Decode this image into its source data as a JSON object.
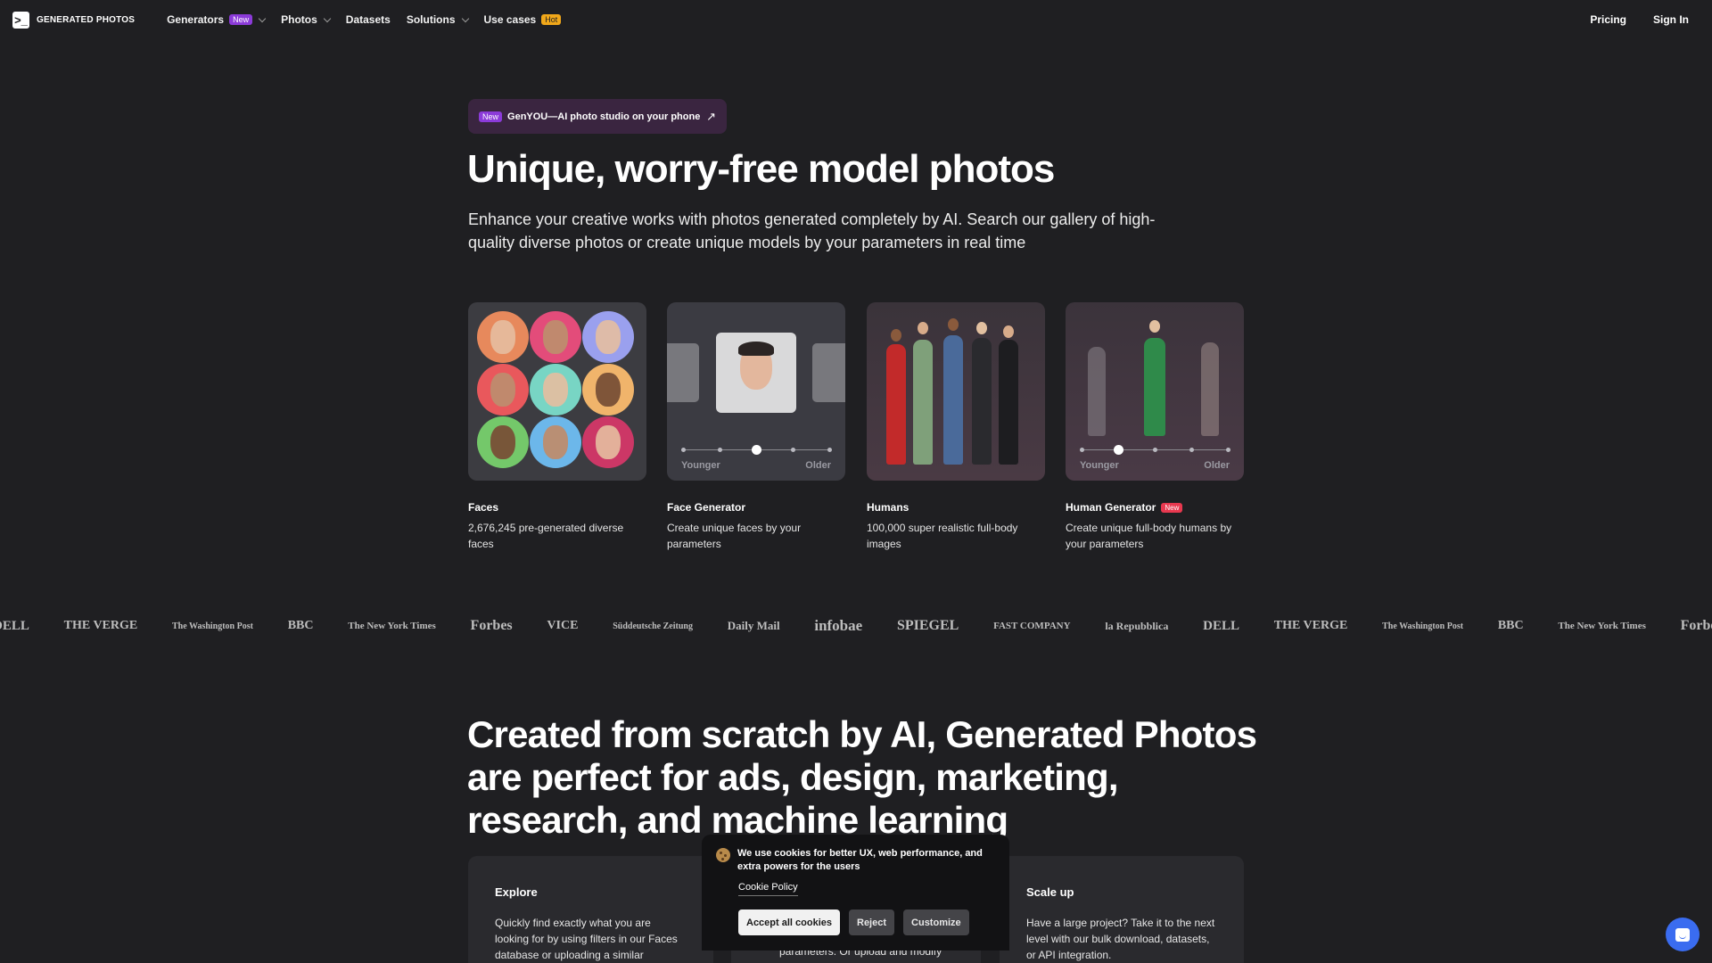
{
  "nav": {
    "logo_glyph": ">_",
    "logo_text": "GENERATED PHOTOS",
    "items": [
      {
        "label": "Generators",
        "badge": "New"
      },
      {
        "label": "Photos"
      },
      {
        "label": "Datasets"
      },
      {
        "label": "Solutions"
      },
      {
        "label": "Use cases",
        "badge": "Hot"
      }
    ],
    "pricing": "Pricing",
    "sign_in": "Sign In"
  },
  "announcement": {
    "badge": "New",
    "text": "GenYOU—AI photo studio on your phone",
    "icon": "arrow-up-right-icon"
  },
  "hero": {
    "title": "Unique, worry-free model photos",
    "subtitle": "Enhance your creative works with photos generated completely by AI. Search our gallery of high-quality diverse photos or create unique models by your parameters in real time"
  },
  "cards": [
    {
      "title": "Faces",
      "desc": "2,676,245 pre-generated diverse faces"
    },
    {
      "title": "Face Generator",
      "desc": "Create unique faces by your parameters",
      "slider_left": "Younger",
      "slider_right": "Older",
      "slider_value": 0.5
    },
    {
      "title": "Humans",
      "desc": "100,000 super realistic full-body images"
    },
    {
      "title": "Human Generator",
      "badge": "New",
      "desc": "Create unique full-body humans by your parameters",
      "slider_left": "Younger",
      "slider_right": "Older",
      "slider_value": 0.25
    }
  ],
  "press_logos": [
    "DELL",
    "THE VERGE",
    "The Washington Post",
    "BBC",
    "The New York Times",
    "Forbes",
    "VICE",
    "Süddeutsche Zeitung",
    "Daily Mail",
    "infobae",
    "SPIEGEL",
    "FAST COMPANY",
    "la Repubblica",
    "DELL",
    "THE VERGE",
    "The Washington Post",
    "BBC",
    "The New York Times",
    "Forbes"
  ],
  "section": {
    "title": "Created from scratch by AI, Generated Photos are perfect for ads, design, marketing, research, and machine learning"
  },
  "features": [
    {
      "title": "Explore",
      "desc": "Quickly find exactly what you are looking for by using filters in our Faces database or uploading a similar"
    },
    {
      "title": "",
      "desc": "parameters. Or upload and modify"
    },
    {
      "title": "Scale up",
      "desc": "Have a large project? Take it to the next level with our bulk download, datasets, or API integration."
    }
  ],
  "cookie": {
    "text": "We use cookies for better UX, web performance, and extra powers for the users",
    "policy": "Cookie Policy",
    "accept": "Accept all cookies",
    "reject": "Reject",
    "customize": "Customize"
  },
  "colors": {
    "background": "#1f1f22",
    "badge_new": "#8c3bd9",
    "badge_hot": "#f0a71a",
    "badge_red": "#e8384f",
    "chat": "#3a6cf0"
  }
}
